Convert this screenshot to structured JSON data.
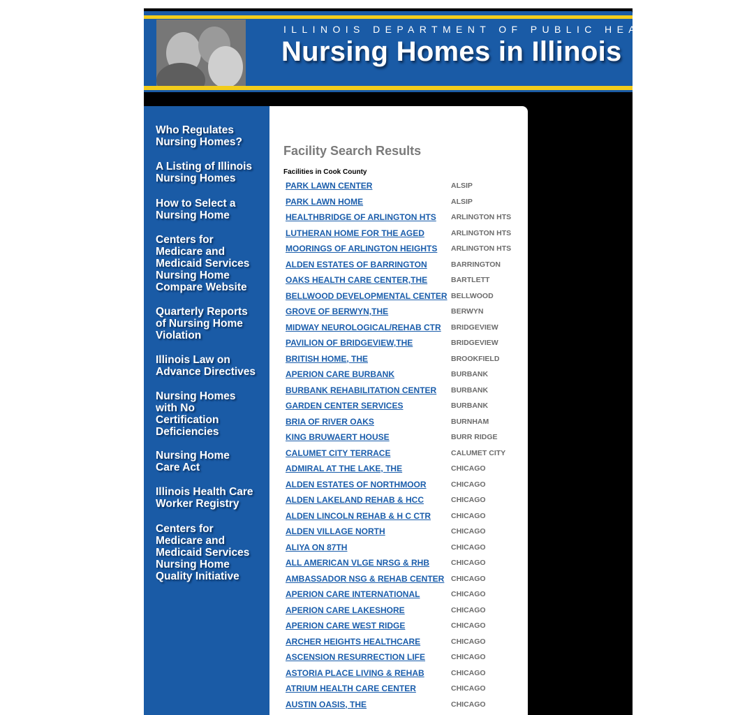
{
  "header": {
    "department": "ILLINOIS DEPARTMENT OF PUBLIC HEALTH",
    "title": "Nursing Homes in Illinois"
  },
  "colors": {
    "brand_blue": "#1a5ba6",
    "accent_yellow": "#f2cc1b",
    "link_blue": "#1a5dab",
    "city_gray": "#6b6b6b"
  },
  "sidebar": {
    "items": [
      {
        "label": "Who Regulates\nNursing Homes?"
      },
      {
        "label": "A Listing of Illinois\nNursing Homes"
      },
      {
        "label": "How to Select a\nNursing Home"
      },
      {
        "label": "Centers for\nMedicare and\nMedicaid Services\nNursing Home\nCompare Website"
      },
      {
        "label": "Quarterly Reports\nof Nursing Home\nViolation"
      },
      {
        "label": "Illinois Law on\nAdvance Directives"
      },
      {
        "label": "Nursing Homes\nwith No\nCertification\nDeficiencies"
      },
      {
        "label": "Nursing Home\nCare Act"
      },
      {
        "label": "Illinois Health Care\nWorker Registry"
      },
      {
        "label": "Centers for\nMedicare and\nMedicaid Services\nNursing Home\nQuality Initiative"
      }
    ]
  },
  "main": {
    "heading": "Facility Search Results",
    "county_label": "Facilities in Cook County",
    "facilities": [
      {
        "name": "PARK LAWN CENTER",
        "city": "ALSIP"
      },
      {
        "name": "PARK LAWN HOME",
        "city": "ALSIP"
      },
      {
        "name": "HEALTHBRIDGE OF ARLINGTON HTS",
        "city": "ARLINGTON HTS"
      },
      {
        "name": "LUTHERAN HOME FOR THE AGED",
        "city": "ARLINGTON HTS"
      },
      {
        "name": "MOORINGS OF ARLINGTON HEIGHTS",
        "city": "ARLINGTON HTS"
      },
      {
        "name": "ALDEN ESTATES OF BARRINGTON",
        "city": "BARRINGTON"
      },
      {
        "name": "OAKS HEALTH CARE CENTER,THE",
        "city": "BARTLETT"
      },
      {
        "name": "BELLWOOD DEVELOPMENTAL CENTER",
        "city": "BELLWOOD"
      },
      {
        "name": "GROVE OF BERWYN,THE",
        "city": "BERWYN"
      },
      {
        "name": "MIDWAY NEUROLOGICAL/REHAB CTR",
        "city": "BRIDGEVIEW"
      },
      {
        "name": "PAVILION OF BRIDGEVIEW,THE",
        "city": "BRIDGEVIEW"
      },
      {
        "name": "BRITISH HOME, THE",
        "city": "BROOKFIELD"
      },
      {
        "name": "APERION CARE BURBANK",
        "city": "BURBANK"
      },
      {
        "name": "BURBANK REHABILITATION CENTER",
        "city": "BURBANK"
      },
      {
        "name": "GARDEN CENTER SERVICES",
        "city": "BURBANK"
      },
      {
        "name": "BRIA OF RIVER OAKS",
        "city": "BURNHAM"
      },
      {
        "name": "KING BRUWAERT HOUSE",
        "city": "BURR RIDGE"
      },
      {
        "name": "CALUMET CITY TERRACE",
        "city": "CALUMET CITY"
      },
      {
        "name": "ADMIRAL AT THE LAKE, THE",
        "city": "CHICAGO"
      },
      {
        "name": "ALDEN ESTATES OF NORTHMOOR",
        "city": "CHICAGO"
      },
      {
        "name": "ALDEN LAKELAND REHAB & HCC",
        "city": "CHICAGO"
      },
      {
        "name": "ALDEN LINCOLN REHAB & H C CTR",
        "city": "CHICAGO"
      },
      {
        "name": "ALDEN VILLAGE NORTH",
        "city": "CHICAGO"
      },
      {
        "name": "ALIYA ON 87TH",
        "city": "CHICAGO"
      },
      {
        "name": "ALL AMERICAN VLGE NRSG & RHB",
        "city": "CHICAGO"
      },
      {
        "name": "AMBASSADOR NSG & REHAB CENTER",
        "city": "CHICAGO"
      },
      {
        "name": "APERION CARE INTERNATIONAL",
        "city": "CHICAGO"
      },
      {
        "name": "APERION CARE LAKESHORE",
        "city": "CHICAGO"
      },
      {
        "name": "APERION CARE WEST RIDGE",
        "city": "CHICAGO"
      },
      {
        "name": "ARCHER HEIGHTS HEALTHCARE",
        "city": "CHICAGO"
      },
      {
        "name": "ASCENSION RESURRECTION LIFE",
        "city": "CHICAGO"
      },
      {
        "name": "ASTORIA PLACE LIVING & REHAB",
        "city": "CHICAGO"
      },
      {
        "name": "ATRIUM HEALTH CARE CENTER",
        "city": "CHICAGO"
      },
      {
        "name": "AUSTIN OASIS, THE",
        "city": "CHICAGO"
      }
    ]
  }
}
